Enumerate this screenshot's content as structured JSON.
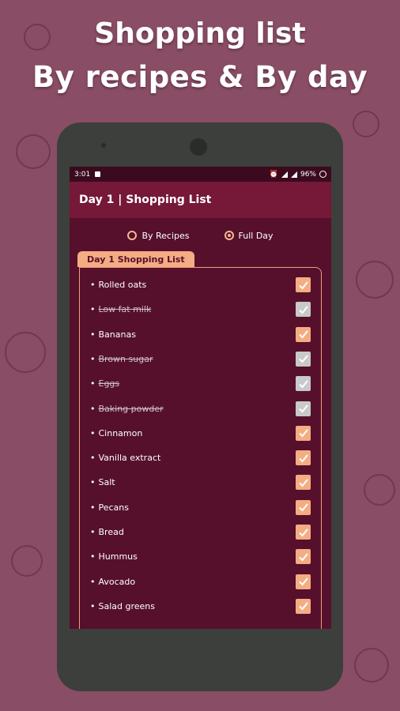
{
  "headline": {
    "line1": "Shopping list",
    "line2": "By recipes & By day"
  },
  "status": {
    "time": "3:01",
    "battery": "96%"
  },
  "appbar": {
    "title": "Day 1 | Shopping List"
  },
  "radios": [
    {
      "label": "By Recipes",
      "selected": false
    },
    {
      "label": "Full Day",
      "selected": true
    }
  ],
  "list": {
    "tab_label": "Day 1 Shopping List",
    "items": [
      {
        "text": "Rolled oats",
        "checked": true,
        "struck": false
      },
      {
        "text": "Low fat milk",
        "checked": true,
        "struck": true
      },
      {
        "text": "Bananas",
        "checked": true,
        "struck": false
      },
      {
        "text": "Brown sugar",
        "checked": true,
        "struck": true
      },
      {
        "text": "Eggs",
        "checked": true,
        "struck": true
      },
      {
        "text": "Baking powder",
        "checked": true,
        "struck": true
      },
      {
        "text": "Cinnamon",
        "checked": true,
        "struck": false
      },
      {
        "text": "Vanilla extract",
        "checked": true,
        "struck": false
      },
      {
        "text": "Salt",
        "checked": true,
        "struck": false
      },
      {
        "text": "Pecans",
        "checked": true,
        "struck": false
      },
      {
        "text": "Bread",
        "checked": true,
        "struck": false
      },
      {
        "text": "Hummus",
        "checked": true,
        "struck": false
      },
      {
        "text": "Avocado",
        "checked": true,
        "struck": false
      },
      {
        "text": "Salad greens",
        "checked": true,
        "struck": false
      }
    ]
  },
  "colors": {
    "background": "#8a4d66",
    "screen": "#56102b",
    "appbar": "#761838",
    "accent": "#f4ad83",
    "done_box": "#c9c9c9"
  }
}
